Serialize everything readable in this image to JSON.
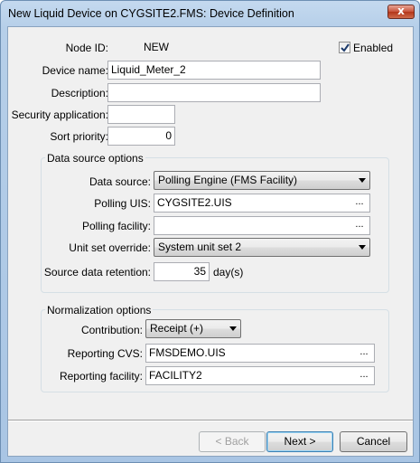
{
  "window": {
    "title": "New Liquid Device on CYGSITE2.FMS: Device Definition",
    "close_glyph": "x"
  },
  "general": {
    "node_id_label": "Node ID:",
    "node_id_value": "NEW",
    "enabled_label": "Enabled",
    "enabled_checked": true,
    "device_name_label": "Device name:",
    "device_name_value": "Liquid_Meter_2",
    "description_label": "Description:",
    "description_value": "",
    "security_app_label": "Security application:",
    "security_app_value": "",
    "sort_priority_label": "Sort priority:",
    "sort_priority_value": "0"
  },
  "data_source": {
    "legend": "Data source options",
    "data_source_label": "Data source:",
    "data_source_value": "Polling Engine (FMS Facility)",
    "polling_uis_label": "Polling UIS:",
    "polling_uis_value": "CYGSITE2.UIS",
    "polling_facility_label": "Polling facility:",
    "polling_facility_value": "",
    "unit_set_label": "Unit set override:",
    "unit_set_value": "System unit set 2",
    "retention_label": "Source data retention:",
    "retention_value": "35",
    "retention_unit": "day(s)",
    "ellipsis": "..."
  },
  "normalization": {
    "legend": "Normalization options",
    "contribution_label": "Contribution:",
    "contribution_value": "Receipt (+)",
    "reporting_cvs_label": "Reporting CVS:",
    "reporting_cvs_value": "FMSDEMO.UIS",
    "reporting_facility_label": "Reporting facility:",
    "reporting_facility_value": "FACILITY2",
    "ellipsis": "..."
  },
  "buttons": {
    "back": "< Back",
    "next": "Next >",
    "cancel": "Cancel"
  }
}
